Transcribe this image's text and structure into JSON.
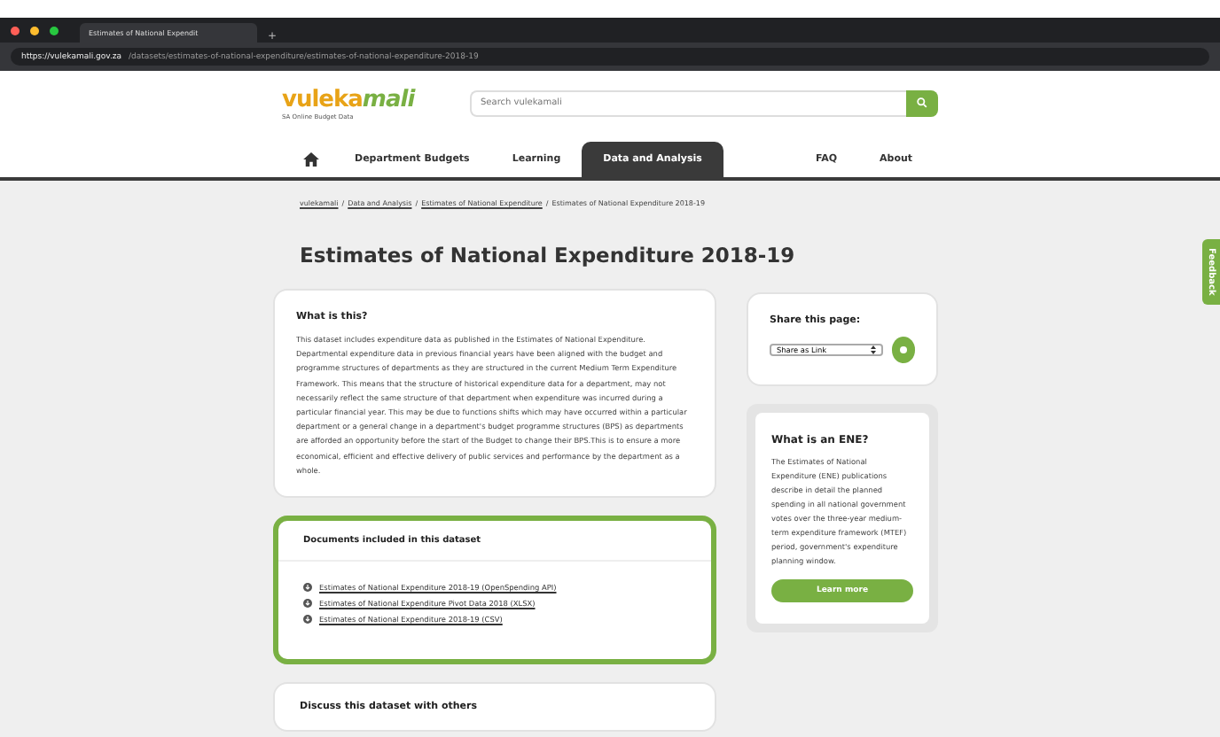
{
  "browser": {
    "tab_title": "Estimates of National Expendit",
    "new_tab": "+",
    "url_host": "https://vulekamali.gov.za",
    "url_path": "/datasets/estimates-of-national-expenditure/estimates-of-national-expenditure-2018-19"
  },
  "header": {
    "logo_text": "vuleka",
    "logo_script": "mali",
    "logo_tagline": "SA Online Budget Data",
    "search_placeholder": "Search vulekamali"
  },
  "nav": [
    {
      "label": "Department Budgets",
      "selected": false
    },
    {
      "label": "Learning",
      "selected": false
    },
    {
      "label": "Data and Analysis",
      "selected": true
    },
    {
      "label": "FAQ",
      "selected": false
    },
    {
      "label": "About",
      "selected": false
    }
  ],
  "breadcrumb_separator": "/",
  "breadcrumbs": [
    "vulekamali",
    "Data and Analysis",
    "Estimates of National Expenditure",
    "Estimates of National Expenditure 2018-19"
  ],
  "title": "Estimates of National Expenditure 2018-19",
  "about": {
    "heading": "What is this?",
    "body": "This dataset includes expenditure data as published in the Estimates of National Expenditure. Departmental expenditure data in previous financial years have been aligned with the budget and programme structures of departments as they are structured in the current Medium Term Expenditure Framework. This means that the structure of historical expenditure data for a department, may not necessarily reflect the same structure of that department when expenditure was incurred during a particular financial year. This may be due to functions shifts which may have occurred within a particular department or a general change in a department's budget programme structures (BPS) as departments are afforded an opportunity before the start of the Budget to change their BPS.This is to ensure a more economical, efficient and effective delivery of public services and performance by the department as a whole."
  },
  "documents": {
    "heading": "Documents included in this dataset",
    "items": [
      "Estimates of National Expenditure 2018-19  (OpenSpending API)",
      "Estimates of National Expenditure Pivot Data 2018  (XLSX)",
      "Estimates of National Expenditure 2018-19  (CSV)"
    ]
  },
  "discuss": {
    "heading": "Discuss this dataset with others"
  },
  "share": {
    "heading": "Share this page:",
    "option": "Share as Link"
  },
  "ene": {
    "heading": "What is an ENE?",
    "body": "The Estimates of National Expenditure (ENE) publications describe in detail the planned spending in all national government votes over the three-year medium-term expenditure framework (MTEF) period, government's expenditure planning window.",
    "button": "Learn more"
  },
  "feedback": "Feedback"
}
